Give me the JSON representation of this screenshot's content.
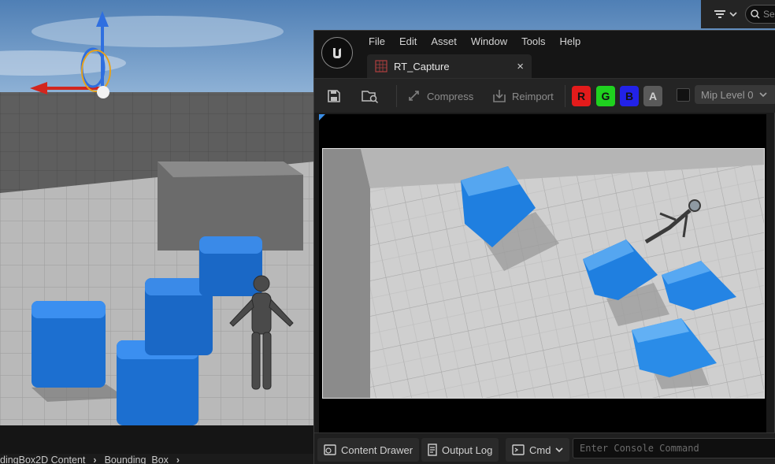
{
  "menu": {
    "items": [
      "File",
      "Edit",
      "Asset",
      "Window",
      "Tools",
      "Help"
    ]
  },
  "asset_tab": {
    "label": "RT_Capture",
    "close_glyph": "×"
  },
  "toolbar": {
    "compress_label": "Compress",
    "reimport_label": "Reimport",
    "channels": [
      {
        "label": "R",
        "color": "#e31b1b"
      },
      {
        "label": "G",
        "color": "#1fd11f"
      },
      {
        "label": "B",
        "color": "#2222e8"
      },
      {
        "label": "A",
        "color": "#5a5a5a"
      }
    ],
    "mip_label": "Mip Level 0"
  },
  "bottom_bar": {
    "content_drawer_label": "Content Drawer",
    "output_log_label": "Output Log",
    "cmd_label": "Cmd",
    "console_placeholder": "Enter Console Command"
  },
  "main_editor": {
    "breadcrumb": [
      "dingBox2D Content",
      "Bounding_Box"
    ],
    "search_placeholder": "Se"
  },
  "colors": {
    "cube_blue": "#1f7fe0",
    "accent": "#3a8ee6",
    "floor": "#bdbdbd"
  }
}
